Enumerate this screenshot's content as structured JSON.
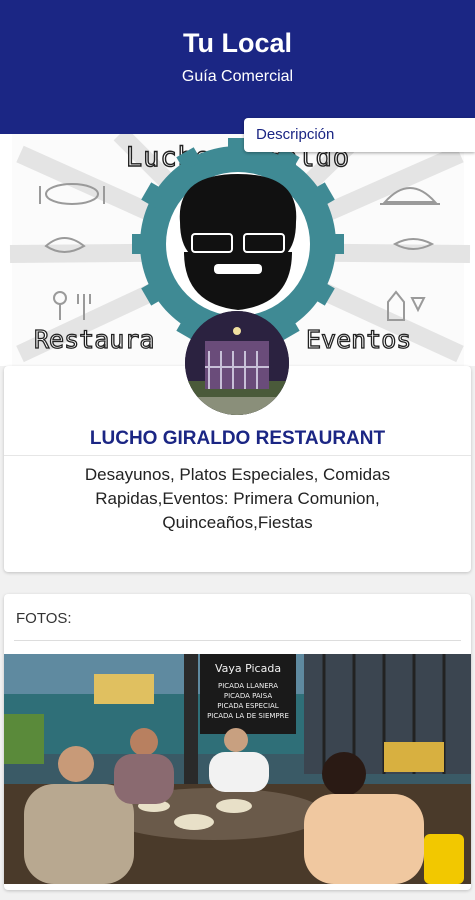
{
  "header": {
    "title": "Tu Local",
    "subtitle": "Guía Comercial"
  },
  "tab": {
    "label": "Descripción"
  },
  "banner": {
    "brand_top": "Lucho Giraldo",
    "brand_left": "Restaura",
    "brand_right": "Eventos"
  },
  "business": {
    "name": "LUCHO GIRALDO RESTAURANT",
    "description": "Desayunos, Platos Especiales, Comidas Rapidas,Eventos: Primera Comunion, Quinceaños,Fiestas"
  },
  "photos": {
    "label": "FOTOS:",
    "sign_lines": [
      "Vaya Picada",
      "PICADA LLANERA",
      "PICADA PAISA",
      "PICADA ESPECIAL",
      "PICADA LA DE SIEMPRE"
    ]
  },
  "colors": {
    "primary": "#1b2684",
    "teal": "#3f8a94",
    "background": "#f1f1f1"
  }
}
